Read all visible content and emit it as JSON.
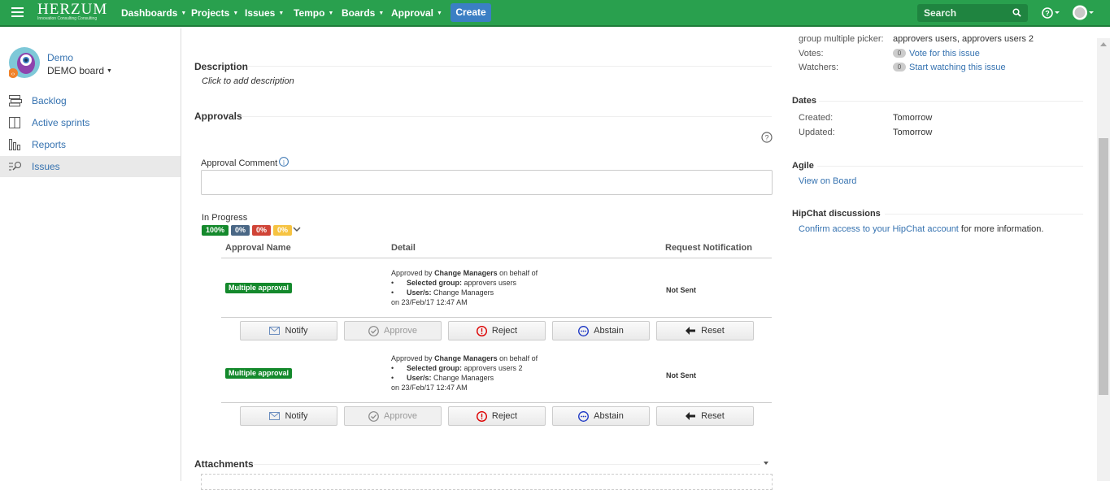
{
  "topnav": {
    "logo_text": "HERZUM",
    "logo_tagline": "Innovation Consulting Consulting",
    "menus": [
      "Dashboards",
      "Projects",
      "Issues",
      "Tempo",
      "Boards",
      "Approval"
    ],
    "create_label": "Create",
    "search_placeholder": "Search",
    "brand_color": "#29a04e"
  },
  "sidebar": {
    "project_name": "Demo",
    "board_name": "DEMO board",
    "items": [
      {
        "label": "Backlog",
        "icon": "backlog-icon"
      },
      {
        "label": "Active sprints",
        "icon": "sprints-icon"
      },
      {
        "label": "Reports",
        "icon": "reports-icon"
      },
      {
        "label": "Issues",
        "icon": "issues-icon",
        "active": true
      }
    ]
  },
  "main": {
    "description_heading": "Description",
    "description_placeholder": "Click to add description",
    "approvals_heading": "Approvals",
    "comment_label": "Approval Comment",
    "status": "In Progress",
    "percentages": [
      {
        "label": "100%",
        "color": "#14892c"
      },
      {
        "label": "0%",
        "color": "#4a6785"
      },
      {
        "label": "0%",
        "color": "#d04437"
      },
      {
        "label": "0%",
        "color": "#f6c342"
      }
    ],
    "columns": {
      "name": "Approval Name",
      "detail": "Detail",
      "notification": "Request Notification"
    },
    "rows": [
      {
        "name": "Multiple approval",
        "detail_prefix": "Approved by",
        "approver": "Change Managers",
        "detail_suffix": "on behalf of",
        "group_label": "Selected group:",
        "group_value": "approvers users",
        "users_label": "User/s:",
        "users_value": "Change Managers",
        "date": "on 23/Feb/17 12:47 AM",
        "notification": "Not Sent"
      },
      {
        "name": "Multiple approval",
        "detail_prefix": "Approved by",
        "approver": "Change Managers",
        "detail_suffix": "on behalf of",
        "group_label": "Selected group:",
        "group_value": "approvers users 2",
        "users_label": "User/s:",
        "users_value": "Change Managers",
        "date": "on 23/Feb/17 12:47 AM",
        "notification": "Not Sent"
      }
    ],
    "buttons": {
      "notify": "Notify",
      "approve": "Approve",
      "reject": "Reject",
      "abstain": "Abstain",
      "reset": "Reset"
    },
    "attachments_heading": "Attachments"
  },
  "right": {
    "group_picker_label": "group multiple picker:",
    "group_picker_value": "approvers users, approvers users 2",
    "votes_label": "Votes:",
    "votes_count": "0",
    "votes_link": "Vote for this issue",
    "watchers_label": "Watchers:",
    "watchers_count": "0",
    "watchers_link": "Start watching this issue",
    "dates_heading": "Dates",
    "created_label": "Created:",
    "created_value": "Tomorrow",
    "updated_label": "Updated:",
    "updated_value": "Tomorrow",
    "agile_heading": "Agile",
    "agile_link": "View on Board",
    "hipchat_heading": "HipChat discussions",
    "hipchat_link": "Confirm access to your HipChat account",
    "hipchat_suffix": " for more information."
  }
}
